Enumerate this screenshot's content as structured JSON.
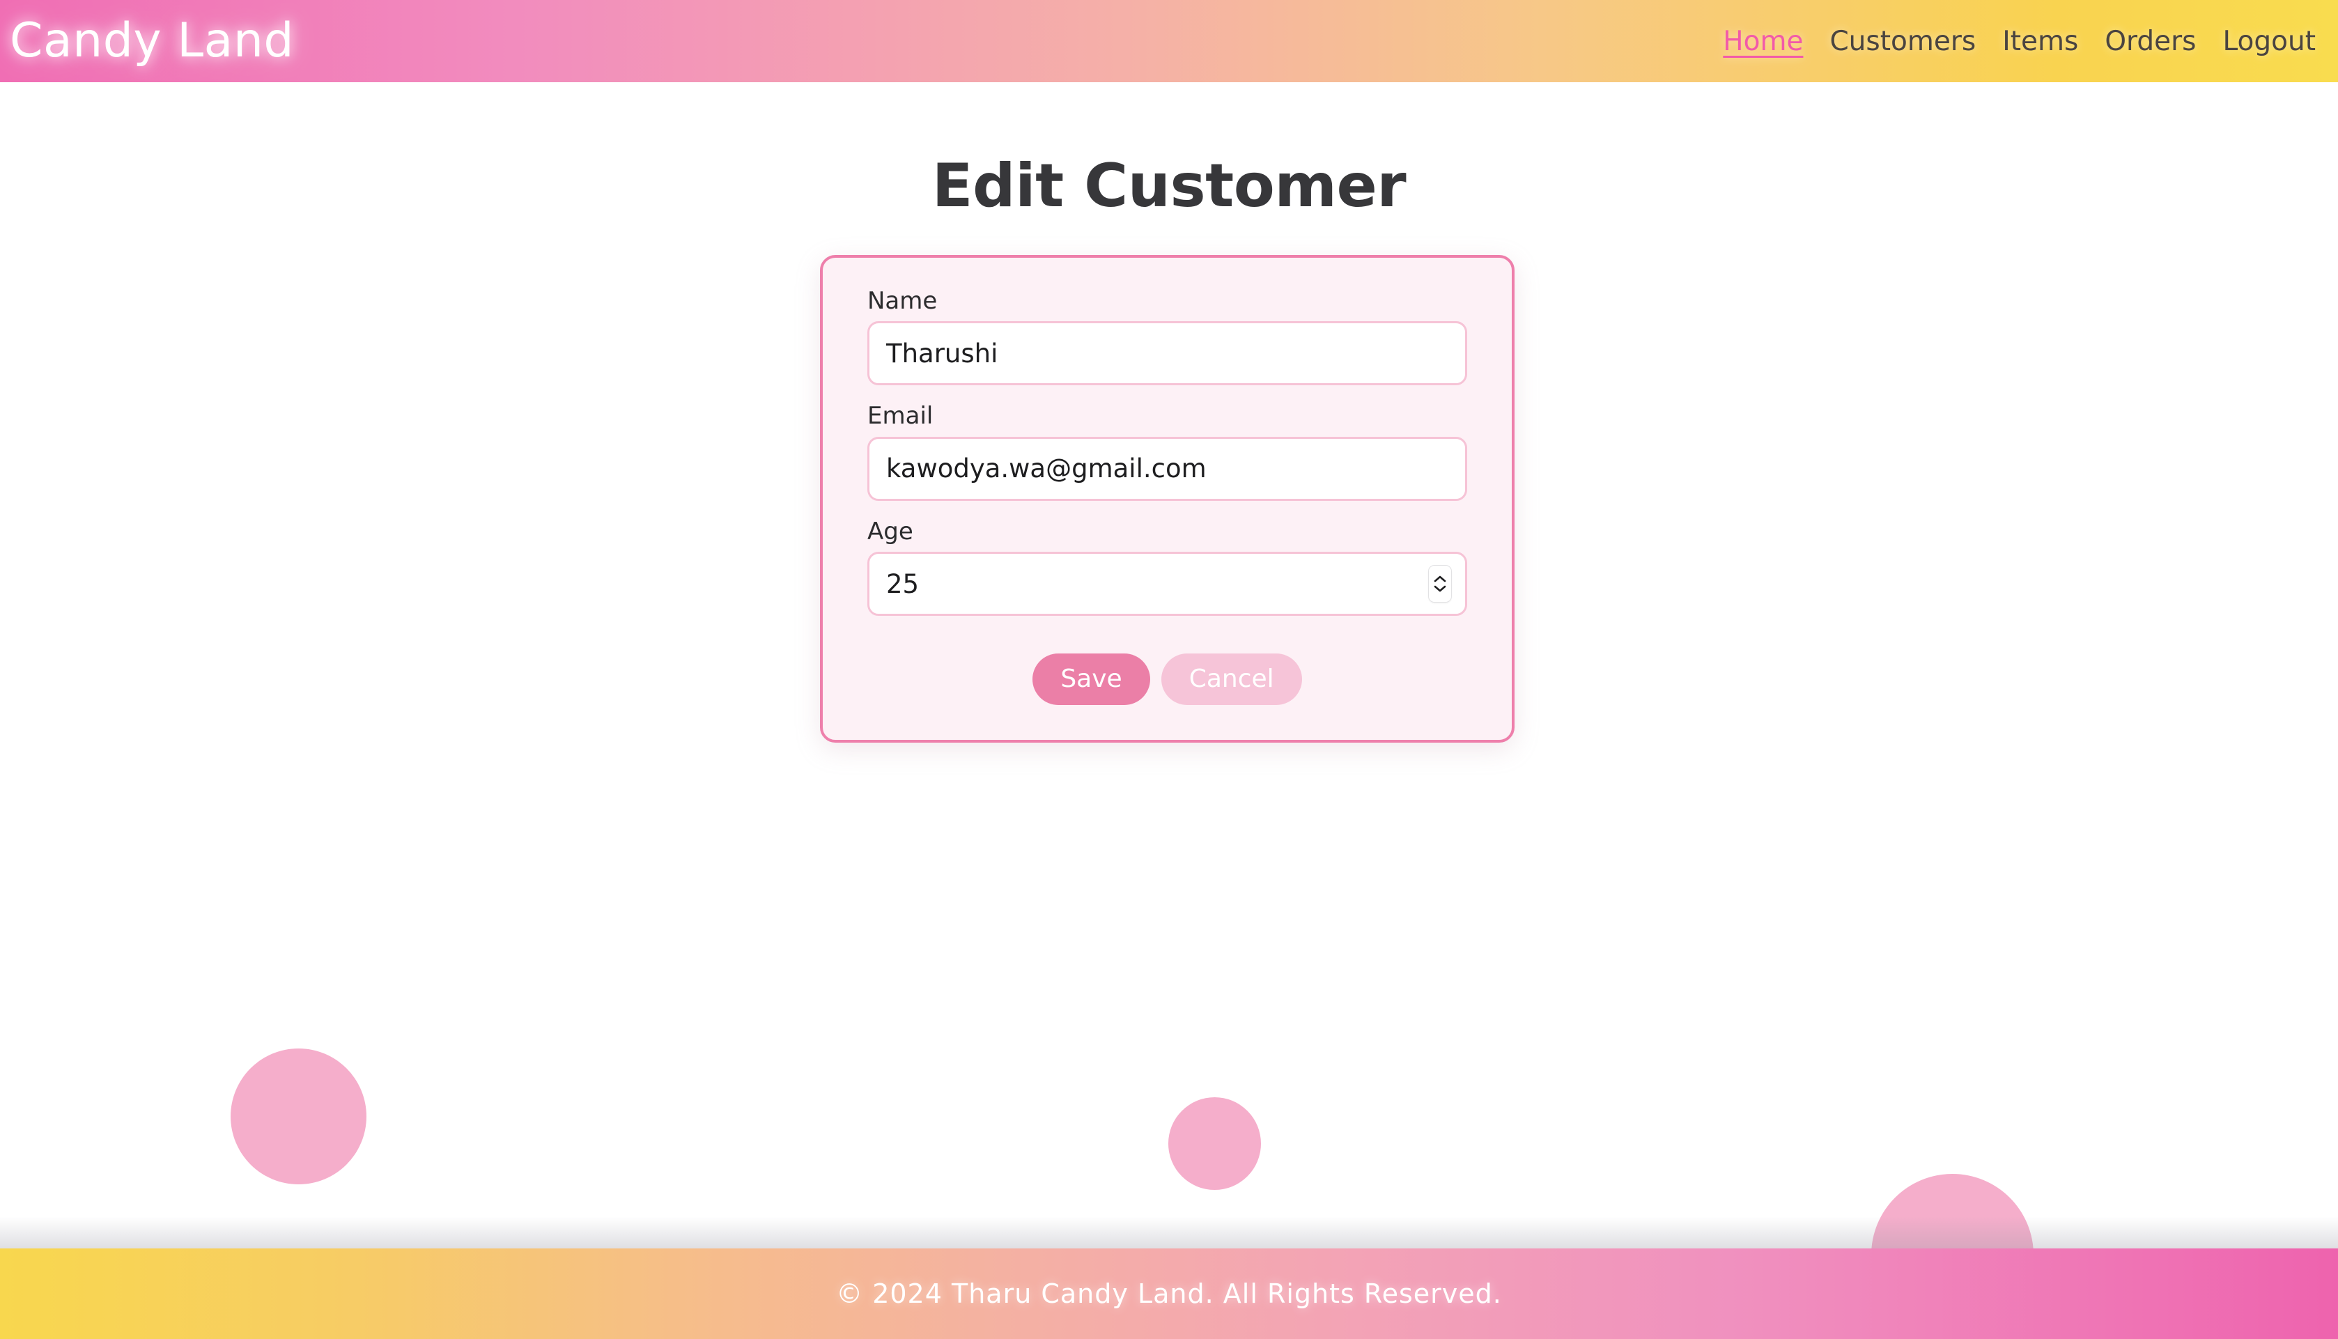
{
  "header": {
    "brand": "Candy Land",
    "nav": [
      {
        "label": "Home",
        "active": true
      },
      {
        "label": "Customers",
        "active": false
      },
      {
        "label": "Items",
        "active": false
      },
      {
        "label": "Orders",
        "active": false
      },
      {
        "label": "Logout",
        "active": false
      }
    ]
  },
  "main": {
    "page_title": "Edit Customer",
    "form": {
      "fields": [
        {
          "label": "Name",
          "value": "Tharushi",
          "type": "text"
        },
        {
          "label": "Email",
          "value": "kawodya.wa@gmail.com",
          "type": "email"
        },
        {
          "label": "Age",
          "value": "25",
          "type": "number"
        }
      ],
      "buttons": {
        "save": "Save",
        "cancel": "Cancel"
      }
    }
  },
  "footer": {
    "text": "© 2024 Tharu Candy Land. All Rights Reserved."
  },
  "colors": {
    "header_gradient_start": "#f06eb4",
    "header_gradient_end": "#f9dc4f",
    "footer_gradient_start": "#f8d74e",
    "footer_gradient_end": "#ee63ae",
    "active_link": "#f25aa9",
    "nav_link": "#4a4440",
    "title": "#37373a",
    "card_border": "#ee7fab",
    "card_background": "#fdf1f6",
    "input_border": "#f6c3d6",
    "save_button": "#eb7fa7",
    "cancel_button": "#f6c4d8",
    "decor_circle": "#f5aecb"
  },
  "decor": {
    "circles": [
      {
        "name": "circle-left"
      },
      {
        "name": "circle-center"
      },
      {
        "name": "circle-right"
      }
    ]
  }
}
